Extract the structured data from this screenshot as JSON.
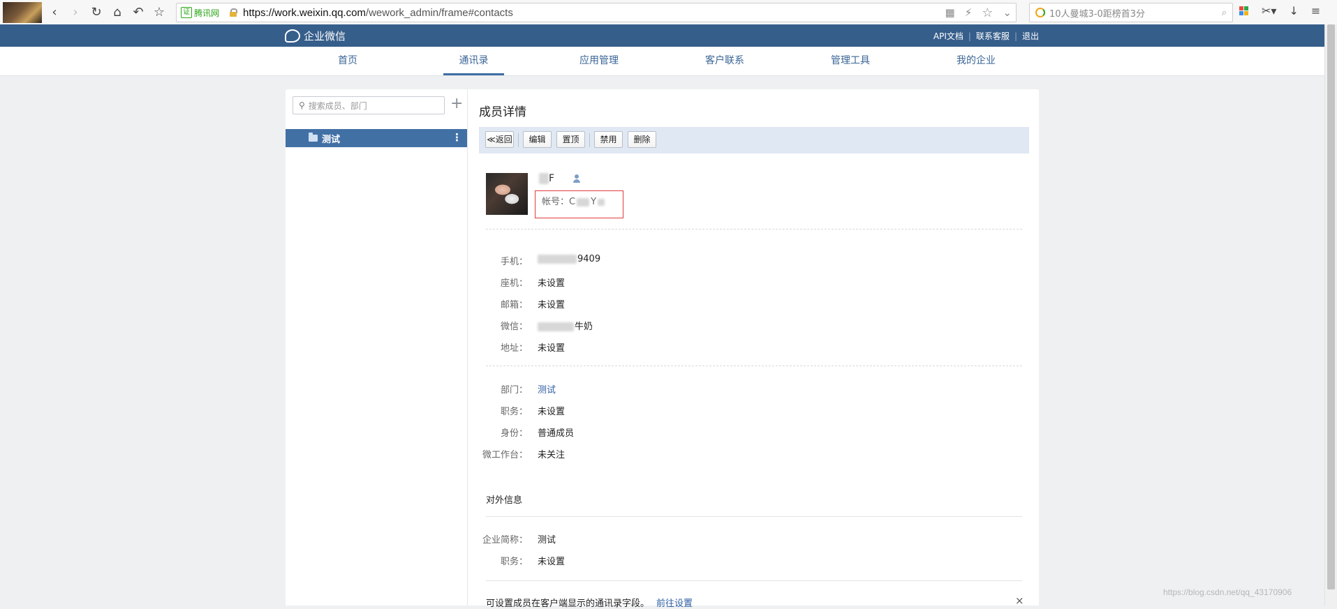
{
  "browser": {
    "cert_label": "腾讯网",
    "cert_badge": "证",
    "url_host": "https://work.weixin.qq.com",
    "url_path": "/wework_admin/frame#contacts",
    "search_text": "10人曼城3-0距榜首3分"
  },
  "header": {
    "logo_text": "企业微信",
    "links": [
      "API文档",
      "联系客服",
      "退出"
    ]
  },
  "nav": {
    "items": [
      "首页",
      "通讯录",
      "应用管理",
      "客户联系",
      "管理工具",
      "我的企业"
    ],
    "active_index": 1
  },
  "sidebar": {
    "search_placeholder": "搜索成员、部门",
    "add_label": "+",
    "department": "测试",
    "more_label": "⋮"
  },
  "detail": {
    "title": "成员详情",
    "toolbar": {
      "back": "≪返回",
      "edit": "编辑",
      "pin": "置顶",
      "disable": "禁用",
      "delete": "删除"
    },
    "account_prefix": "帐号：",
    "account_visible": "C",
    "account_visible2": "Y",
    "name_visible": "F",
    "contact_fields": [
      {
        "label": "手机：",
        "value": "9409"
      },
      {
        "label": "座机：",
        "value": "未设置"
      },
      {
        "label": "邮箱：",
        "value": "未设置"
      },
      {
        "label": "微信：",
        "value": "牛奶"
      },
      {
        "label": "地址：",
        "value": "未设置"
      }
    ],
    "org_fields": [
      {
        "label": "部门：",
        "value": "测试"
      },
      {
        "label": "职务：",
        "value": "未设置"
      },
      {
        "label": "身份：",
        "value": "普通成员"
      },
      {
        "label": "微工作台：",
        "value": "未关注"
      }
    ],
    "external_title": "对外信息",
    "external_fields": [
      {
        "label": "企业简称：",
        "value": "测试"
      },
      {
        "label": "职务：",
        "value": "未设置"
      }
    ],
    "tip_text": "可设置成员在客户端显示的通讯录字段。",
    "tip_link": "前往设置",
    "close_label": "×"
  },
  "watermark": "https://blog.csdn.net/qq_43170906",
  "colors": {
    "header_bg": "#365e8b",
    "accent": "#4170a5",
    "toolbar_bg": "#dfe8f3",
    "highlight_border": "#e2393b"
  }
}
